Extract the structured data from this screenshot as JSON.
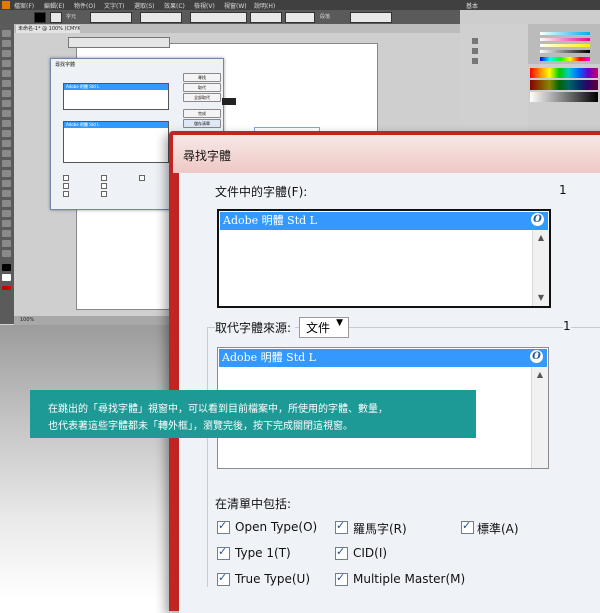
{
  "app": {
    "menu_items": [
      "檔案(F)",
      "編輯(E)",
      "物件(O)",
      "文字(T)",
      "選取(S)",
      "效果(C)",
      "檢視(V)",
      "視窗(W)",
      "說明(H)"
    ],
    "workspace": "基本",
    "ctrl_labels": [
      "字元",
      "段落"
    ],
    "tab_title": "未命名-1* @ 100% (CMYK/預視)",
    "status_zoom": "100%",
    "accent_color": "#e07b00"
  },
  "mini_dialog": {
    "title": "尋找字體",
    "font_item": "Adobe 明體 Std L",
    "buttons": [
      "尋找",
      "取代",
      "全部取代",
      "完成",
      "儲存清單",
      "結束"
    ]
  },
  "dialog": {
    "title": "尋找字體",
    "doc_fonts_label": "文件中的字體(F):",
    "doc_fonts_count": "1",
    "doc_fonts": [
      "Adobe 明體 Std L"
    ],
    "replace_source_label": "取代字體來源:",
    "replace_source_value": "文件",
    "replace_count": "1",
    "replace_fonts": [
      "Adobe 明體 Std L"
    ],
    "include_label": "在清單中包括:",
    "checkboxes": [
      {
        "label": "Open Type(O)",
        "checked": true
      },
      {
        "label": "羅馬字(R)",
        "checked": true
      },
      {
        "label": "標準(A)",
        "checked": true
      },
      {
        "label": "Type 1(T)",
        "checked": true
      },
      {
        "label": "CID(I)",
        "checked": true
      },
      {
        "label": "True Type(U)",
        "checked": true
      },
      {
        "label": "Multiple Master(M)",
        "checked": true
      }
    ],
    "font_icon": "opentype-icon",
    "frame_color": "#c22323",
    "selection_color": "#3399ff"
  },
  "caption": {
    "line1": "在跳出的「尋找字體」視窗中，可以看到目前檔案中，所使用的字體、數量，",
    "line2": "也代表著這些字體都未「轉外框」，瀏覽完後，按下完成關閉這視窗。",
    "bg_color": "#1d9a96"
  }
}
